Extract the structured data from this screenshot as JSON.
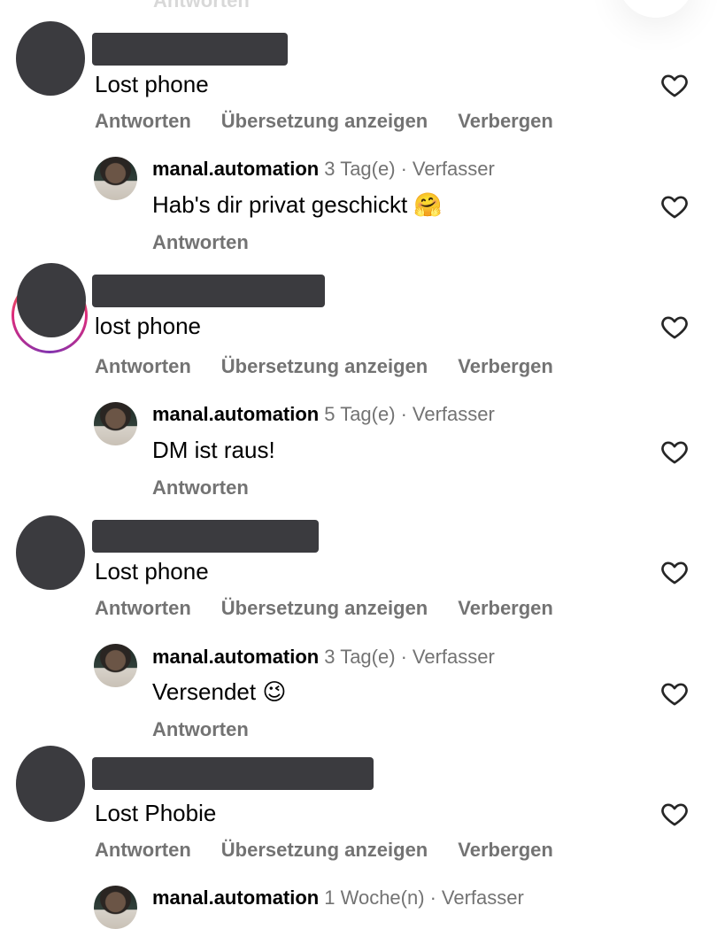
{
  "top_partial_label": "Antworten",
  "comments": [
    {
      "text": "Lost phone",
      "actions": [
        "Antworten",
        "Übersetzung anzeigen",
        "Verbergen"
      ],
      "reply": {
        "username": "manal.automation",
        "age": "3 Tag(e)",
        "separator": "·",
        "role": "Verfasser",
        "text": "Hab's dir privat geschickt",
        "emoji": "🤗",
        "action": "Antworten"
      }
    },
    {
      "text": "lost phone",
      "actions": [
        "Antworten",
        "Übersetzung anzeigen",
        "Verbergen"
      ],
      "reply": {
        "username": "manal.automation",
        "age": "5 Tag(e)",
        "separator": "·",
        "role": "Verfasser",
        "text": "DM ist raus!",
        "emoji": "",
        "action": "Antworten"
      }
    },
    {
      "text": "Lost phone",
      "actions": [
        "Antworten",
        "Übersetzung anzeigen",
        "Verbergen"
      ],
      "reply": {
        "username": "manal.automation",
        "age": "3 Tag(e)",
        "separator": "·",
        "role": "Verfasser",
        "text": "Versendet",
        "emoji": "😉",
        "action": "Antworten"
      }
    },
    {
      "text": "Lost Phobie",
      "actions": [
        "Antworten",
        "Übersetzung anzeigen",
        "Verbergen"
      ],
      "reply": {
        "username": "manal.automation",
        "age": "1 Woche(n)",
        "separator": "·",
        "role": "Verfasser",
        "text": "",
        "emoji": "",
        "action": ""
      }
    }
  ],
  "icons": {
    "like": "heart-outline-icon"
  },
  "colors": {
    "text": "#000000",
    "secondary": "#737373",
    "redaction": "#3b3b3f"
  }
}
